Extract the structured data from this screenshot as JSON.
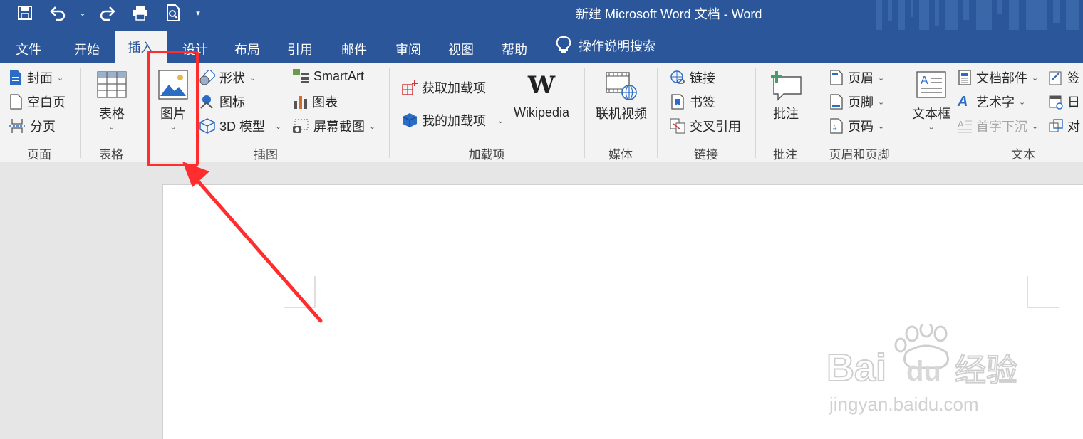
{
  "window": {
    "title": "新建 Microsoft Word 文档  -  Word"
  },
  "tabs": [
    {
      "label": "文件"
    },
    {
      "label": "开始"
    },
    {
      "label": "插入"
    },
    {
      "label": "设计"
    },
    {
      "label": "布局"
    },
    {
      "label": "引用"
    },
    {
      "label": "邮件"
    },
    {
      "label": "审阅"
    },
    {
      "label": "视图"
    },
    {
      "label": "帮助"
    }
  ],
  "active_tab": "插入",
  "tell_me": "操作说明搜索",
  "ribbon": {
    "pages": {
      "cover": "封面",
      "blank": "空白页",
      "break": "分页",
      "label": "页面"
    },
    "tables": {
      "table": "表格",
      "label": "表格"
    },
    "illustrations": {
      "picture": "图片",
      "shapes": "形状",
      "icons": "图标",
      "model3d": "3D 模型",
      "smartart": "SmartArt",
      "chart": "图表",
      "screenshot": "屏幕截图",
      "label": "插图"
    },
    "addins": {
      "get": "获取加载项",
      "mine": "我的加载项",
      "wikipedia": "Wikipedia",
      "label": "加载项"
    },
    "media": {
      "video": "联机视频",
      "label": "媒体"
    },
    "links": {
      "link": "链接",
      "bookmark": "书签",
      "xref": "交叉引用",
      "label": "链接"
    },
    "comments": {
      "comment": "批注",
      "label": "批注"
    },
    "headerfooter": {
      "header": "页眉",
      "footer": "页脚",
      "pagenum": "页码",
      "label": "页眉和页脚"
    },
    "text": {
      "textbox": "文本框",
      "quickparts": "文档部件",
      "wordart": "艺术字",
      "dropcap": "首字下沉",
      "signature": "签",
      "datetime": "日",
      "object": "对",
      "label": "文本"
    }
  },
  "watermark": {
    "brand": "Bai",
    "brand2": "du",
    "cn": "经验",
    "url": "jingyan.baidu.com"
  },
  "colors": {
    "accent": "#2b579a",
    "highlight": "#ff2d2d"
  }
}
